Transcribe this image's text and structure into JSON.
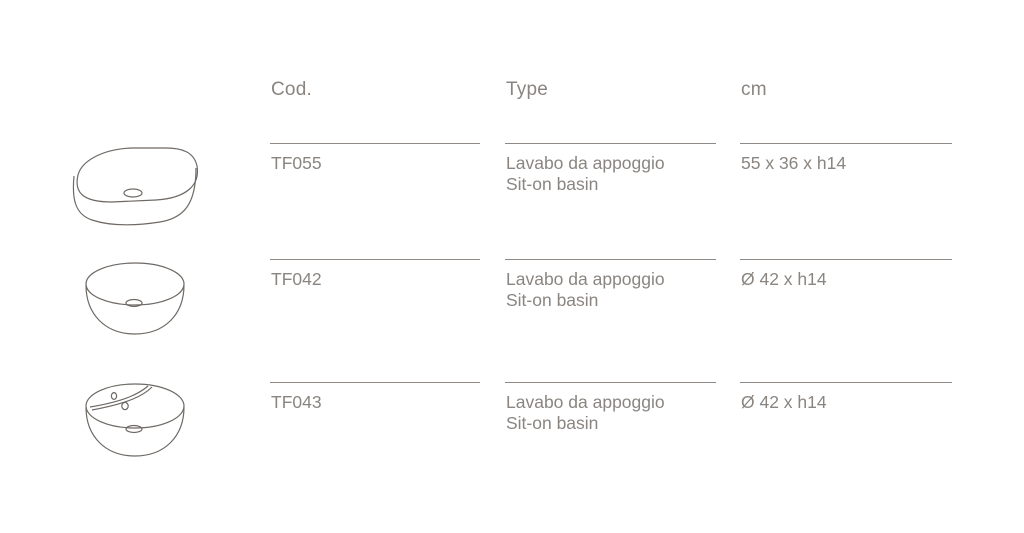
{
  "table": {
    "headers": {
      "code": "Cod.",
      "type": "Type",
      "size": "cm"
    },
    "rows": [
      {
        "code": "TF055",
        "type_it": "Lavabo da appoggio",
        "type_en": "Sit-on basin",
        "size": "55 x 36 x h14",
        "icon": "oval-basin-icon"
      },
      {
        "code": "TF042",
        "type_it": "Lavabo da appoggio",
        "type_en": "Sit-on basin",
        "size": "Ø 42 x h14",
        "icon": "round-basin-icon"
      },
      {
        "code": "TF043",
        "type_it": "Lavabo da appoggio",
        "type_en": "Sit-on basin",
        "size": "Ø 42 x h14",
        "icon": "round-basin-with-tap-holes-icon"
      }
    ]
  },
  "colors": {
    "text": "#8a8580",
    "rule": "#8f8a85",
    "drawing": "#6e6964"
  }
}
